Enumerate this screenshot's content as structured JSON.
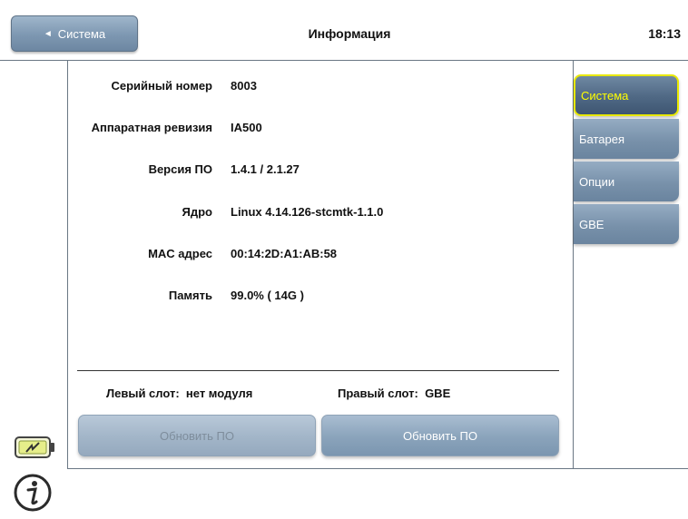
{
  "header": {
    "back_label": "Система",
    "title": "Информация",
    "time": "18:13"
  },
  "info": {
    "rows": [
      {
        "label": "Серийный номер",
        "value": "8003"
      },
      {
        "label": "Аппаратная ревизия",
        "value": "IA500"
      },
      {
        "label": "Версия ПО",
        "value": "1.4.1 / 2.1.27"
      },
      {
        "label": "Ядро",
        "value": "Linux 4.14.126-stcmtk-1.1.0"
      },
      {
        "label": "MAC адрес",
        "value": "00:14:2D:A1:AB:58"
      },
      {
        "label": "Память",
        "value": "99.0% ( 14G )"
      }
    ]
  },
  "slots": {
    "left": "Левый слот:  нет модуля",
    "right": "Правый слот:  GBE"
  },
  "buttons": {
    "update_left": "Обновить ПО",
    "update_right": "Обновить ПО"
  },
  "tabs": [
    {
      "label": "Система",
      "active": true
    },
    {
      "label": "Батарея",
      "active": false
    },
    {
      "label": "Опции",
      "active": false
    },
    {
      "label": "GBE",
      "active": false
    }
  ],
  "icons": {
    "battery": "battery-charging-icon",
    "info": "info-icon",
    "back": "triangle-left-icon"
  },
  "colors": {
    "active_tab_text": "#ffff00",
    "button_blue": "#7d97b1"
  }
}
